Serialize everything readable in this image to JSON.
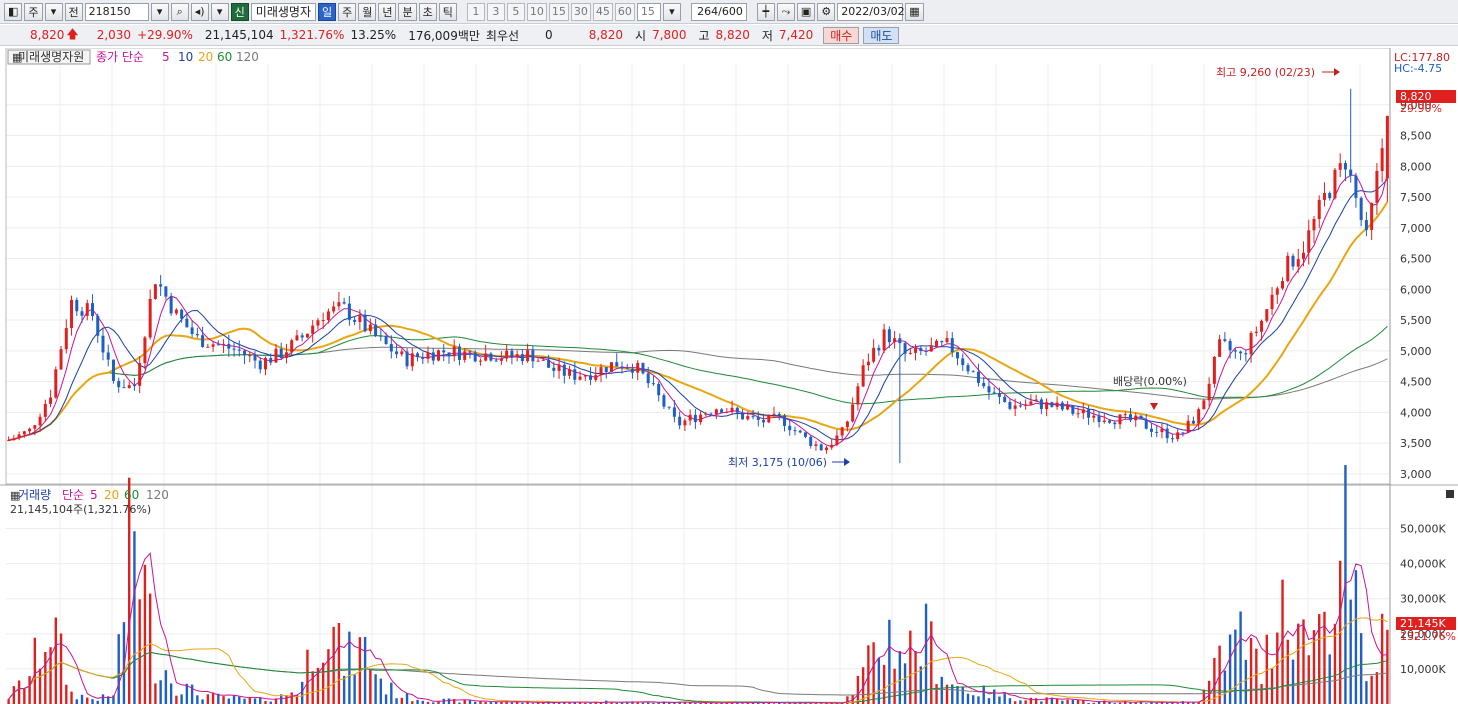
{
  "toolbar": {
    "type_main": "주",
    "type_prev": "전",
    "code": "218150",
    "shin": "신",
    "stock_name": "미래생명자",
    "periods": [
      "일",
      "주",
      "월",
      "년",
      "분",
      "초",
      "틱"
    ],
    "active_period": "일",
    "intervals": [
      "1",
      "3",
      "5",
      "10",
      "15",
      "30",
      "45",
      "60"
    ],
    "interval_input": "15",
    "count": "264",
    "count_total": "/600",
    "date": "2022/03/02"
  },
  "quote": {
    "price": "8,820",
    "change": "2,030",
    "change_rate": "+29.90%",
    "volume": "21,145,104",
    "volume_rate": "1,321.76%",
    "turnover": "13.25%",
    "amount": "176,009백만",
    "priority_label": "최우선",
    "priority_value": "0",
    "close": "8,820",
    "open_label": "시",
    "open": "7,800",
    "high_label": "고",
    "high": "8,820",
    "low_label": "저",
    "low": "7,420",
    "buy_label": "매수",
    "sell_label": "매도"
  },
  "price_panel": {
    "title": "미래생명자원",
    "ma_label": "종가 단순",
    "ma_periods": [
      "5",
      "10",
      "20",
      "60",
      "120"
    ],
    "lc": "LC:177.80",
    "hc": "HC:-4.75",
    "current_price_tag": "8,820",
    "current_rate_tag": "29.90%",
    "high_annotation": "최고 9,260 (02/23)",
    "low_annotation": "최저 3,175 (10/06)",
    "dividend_annotation": "배당락(0.00%)",
    "y_ticks": [
      "9,000",
      "8,500",
      "8,000",
      "7,500",
      "7,000",
      "6,500",
      "6,000",
      "5,500",
      "5,000",
      "4,500",
      "4,000",
      "3,500",
      "3,000"
    ]
  },
  "volume_panel": {
    "title": "거래량",
    "ma_label": "단순",
    "ma_periods": [
      "5",
      "20",
      "60",
      "120"
    ],
    "volume_text": "21,145,104주(1,321.76%)",
    "current_tag": "21,145K",
    "current_rate_tag": "1321.76%",
    "y_ticks": [
      "50,000K",
      "40,000K",
      "30,000K",
      "20,000K",
      "10,000K"
    ]
  },
  "colors": {
    "up": "#e0201f",
    "down": "#1f5fc4",
    "ma5": "#c8159a",
    "ma10": "#1c3fa8",
    "ma20": "#e8a712",
    "ma60": "#1f8a36",
    "ma120": "#7a7a7a"
  },
  "chart_data": {
    "type": "candlestick",
    "symbol": "218150",
    "title": "미래생명자원",
    "price_ylim": [
      2900,
      9500
    ],
    "volume_ylim": [
      0,
      57000
    ],
    "volume_unit": "K",
    "key_points": [
      {
        "label": "최고",
        "value": 9260,
        "date": "02/23"
      },
      {
        "label": "최저",
        "value": 3175,
        "date": "10/06"
      }
    ],
    "last": {
      "open": 7800,
      "high": 8820,
      "low": 7420,
      "close": 8820,
      "volume": 21145104
    },
    "price_anchor": [
      3550,
      3700,
      4300,
      5800,
      5600,
      4500,
      4400,
      6200,
      5600,
      5200,
      5100,
      5000,
      4800,
      4950,
      5200,
      5600,
      5700,
      5400,
      5100,
      4850,
      4950,
      5000,
      4950,
      4950,
      4900,
      4950,
      4700,
      4600,
      4650,
      4800,
      4750,
      4300,
      3800,
      3950,
      4100,
      3950,
      3850,
      3900,
      3600,
      3400,
      3700,
      4800,
      5300,
      4900,
      5000,
      5100,
      4700,
      4300,
      4100,
      4150,
      4100,
      4000,
      3950,
      3900,
      3850,
      3700,
      3600,
      4000,
      5100,
      4900,
      5500,
      6300,
      6700,
      7500,
      8100,
      6800,
      8820
    ],
    "volume_anchor": [
      2000,
      8000,
      24000,
      3000,
      1500,
      2000,
      52000,
      14000,
      6000,
      3000,
      2000,
      1500,
      1200,
      2000,
      5000,
      28000,
      12000,
      16000,
      5000,
      2000,
      1200,
      1000,
      800,
      700,
      600,
      500,
      500,
      500,
      500,
      800,
      600,
      500,
      500,
      500,
      400,
      400,
      400,
      300,
      300,
      300,
      600,
      9000,
      20000,
      15000,
      19000,
      6000,
      4000,
      3000,
      2000,
      1500,
      1200,
      800,
      700,
      600,
      500,
      500,
      500,
      1000,
      12000,
      20000,
      8000,
      35000,
      18000,
      26000,
      45000,
      5000,
      21145
    ]
  }
}
